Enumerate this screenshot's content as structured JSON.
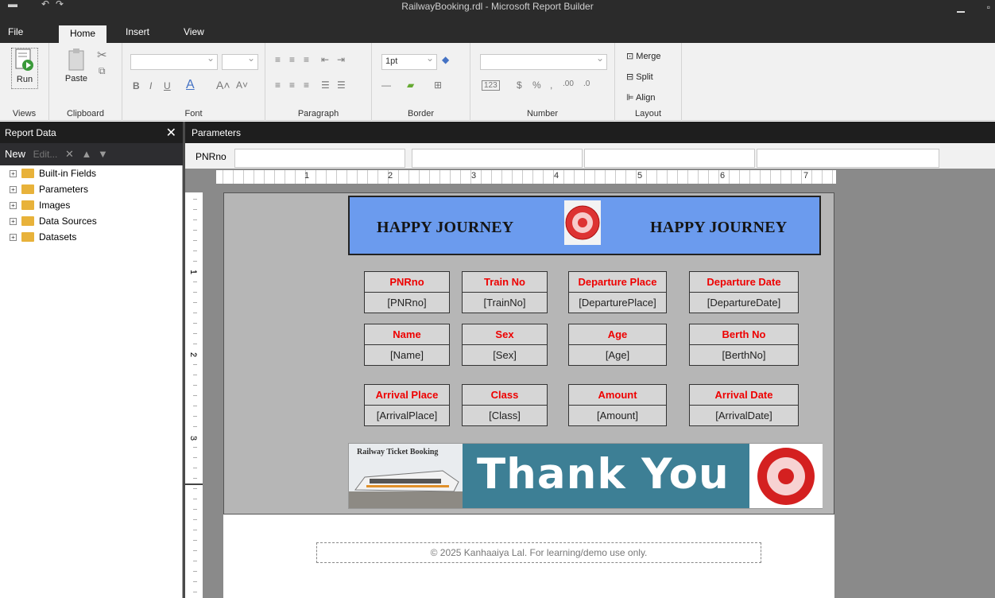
{
  "window": {
    "title": "RailwayBooking.rdl - Microsoft Report Builder"
  },
  "menu": {
    "tabs": [
      "File",
      "Home",
      "Insert",
      "View"
    ]
  },
  "ribbon": {
    "groups": [
      "Views",
      "Clipboard",
      "Font",
      "Paragraph",
      "Border",
      "Number",
      "Layout"
    ],
    "run_label": "Run",
    "paste_label": "Paste",
    "border_width": "1pt",
    "merge_label": "Merge",
    "split_label": "Split",
    "align_label": "Align"
  },
  "report_data": {
    "title": "Report Data",
    "new_label": "New",
    "edit_label": "Edit...",
    "tree": [
      "Built-in Fields",
      "Parameters",
      "Images",
      "Data Sources",
      "Datasets"
    ]
  },
  "parameters": {
    "title": "Parameters",
    "pnr_label": "PNRno"
  },
  "ruler": {
    "marks": [
      "1",
      "2",
      "3",
      "4",
      "5",
      "6",
      "7"
    ],
    "vmarks": [
      "1",
      "2",
      "3"
    ]
  },
  "report": {
    "header_left": "HAPPY JOURNEY",
    "header_right": "HAPPY JOURNEY",
    "cards": [
      {
        "label": "PNRno",
        "value": "[PNRno]"
      },
      {
        "label": "Train No",
        "value": "[TrainNo]"
      },
      {
        "label": "Departure Place",
        "value": "[DeparturePlace]"
      },
      {
        "label": "Departure Date",
        "value": "[DepartureDate]"
      },
      {
        "label": "Name",
        "value": "[Name]"
      },
      {
        "label": "Sex",
        "value": "[Sex]"
      },
      {
        "label": "Age",
        "value": "[Age]"
      },
      {
        "label": "Berth No",
        "value": "[BerthNo]"
      },
      {
        "label": "Arrival Place",
        "value": "[ArrivalPlace]"
      },
      {
        "label": "Class",
        "value": "[Class]"
      },
      {
        "label": "Amount",
        "value": "[Amount]"
      },
      {
        "label": "Arrival Date",
        "value": "[ArrivalDate]"
      }
    ],
    "banner_label": "Railway Ticket Booking",
    "thank_you": "Thank You",
    "footer": "© 2025 Kanhaaiya Lal. For learning/demo use only."
  },
  "colors": {
    "header_blue": "#6b9bee",
    "label_red": "#ee0000",
    "canvas_gray": "#b6b6b6"
  }
}
